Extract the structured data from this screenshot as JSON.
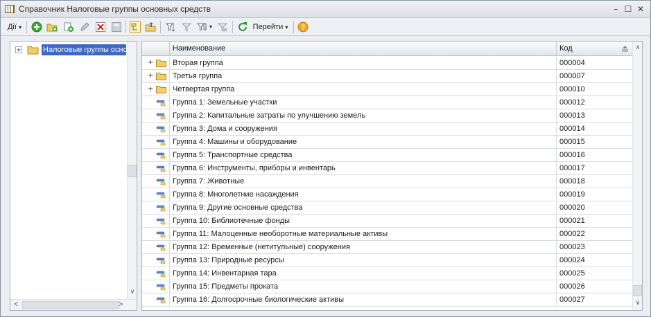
{
  "window": {
    "title": "Справочник Налоговые группы основных средств"
  },
  "toolbar": {
    "actions_label": "Дії",
    "goto_label": "Перейти",
    "help_label": "?"
  },
  "tree": {
    "root_label": "Налоговые группы осно"
  },
  "table": {
    "columns": [
      "Наименование",
      "Код"
    ],
    "rows": [
      {
        "type": "folder",
        "name": "Вторая группа",
        "code": "000004"
      },
      {
        "type": "folder",
        "name": "Третья группа",
        "code": "000007"
      },
      {
        "type": "folder",
        "name": "Четвертая группа",
        "code": "000010"
      },
      {
        "type": "item",
        "name": "Группа 1: Земельные участки",
        "code": "000012"
      },
      {
        "type": "item",
        "name": "Группа 2: Капитальные затраты по улучшению земель",
        "code": "000013"
      },
      {
        "type": "item",
        "name": "Группа 3: Дома и сооружения",
        "code": "000014"
      },
      {
        "type": "item",
        "name": "Группа 4: Машины и оборудование",
        "code": "000015"
      },
      {
        "type": "item",
        "name": "Группа 5: Транспортные средства",
        "code": "000016"
      },
      {
        "type": "item",
        "name": "Группа 6: Инструменты, приборы и инвентарь",
        "code": "000017"
      },
      {
        "type": "item",
        "name": "Группа 7: Животные",
        "code": "000018"
      },
      {
        "type": "item",
        "name": "Группа 8: Многолетние насаждения",
        "code": "000019"
      },
      {
        "type": "item",
        "name": "Группа 9: Другие основные средства",
        "code": "000020"
      },
      {
        "type": "item",
        "name": "Группа 10: Библиотечные фонды",
        "code": "000021"
      },
      {
        "type": "item",
        "name": "Группа 11: Малоценные необоротные материальные активы",
        "code": "000022"
      },
      {
        "type": "item",
        "name": "Группа 12: Временные (нетитульные) сооружения",
        "code": "000023"
      },
      {
        "type": "item",
        "name": "Группа 13: Природные ресурсы",
        "code": "000024"
      },
      {
        "type": "item",
        "name": "Группа 14: Инвентарная тара",
        "code": "000025"
      },
      {
        "type": "item",
        "name": "Группа 15: Предметы проката",
        "code": "000026"
      },
      {
        "type": "item",
        "name": "Группа 16: Долгосрочные биологические активы",
        "code": "000027"
      }
    ]
  },
  "colors": {
    "selection": "#3d68c4",
    "folder": "#e8c25a"
  }
}
